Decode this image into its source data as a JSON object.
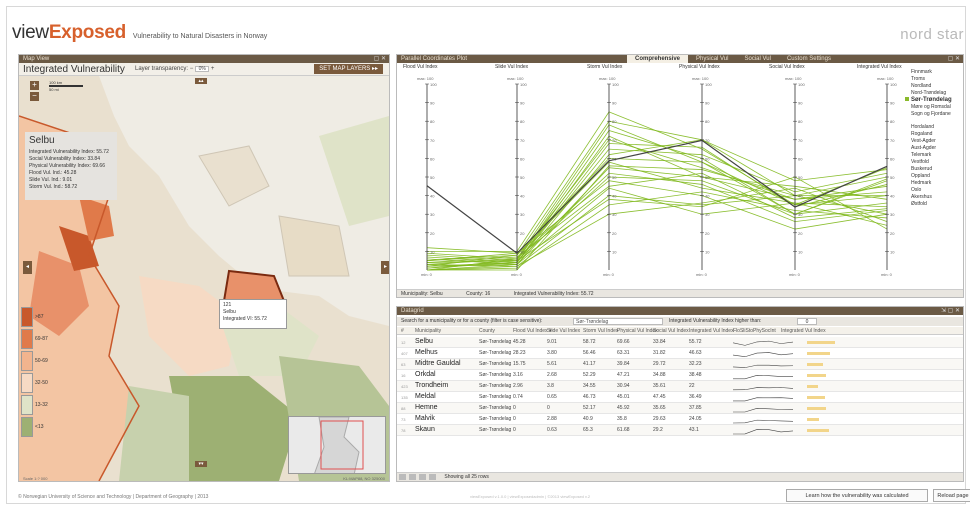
{
  "header": {
    "logo_view": "view",
    "logo_exposed": "Exposed",
    "subtitle": "Vulnerability to Natural Disasters in Norway",
    "brand": "nord star"
  },
  "map": {
    "panel_title": "Map View",
    "map_name": "Integrated Vulnerability",
    "transparency_label": "Layer transparency:",
    "transparency_value": "0%",
    "set_layers": "SET MAP LAYERS",
    "scale_top": "100 km",
    "scale_bottom": "50 mi",
    "info": {
      "name": "Selbu",
      "lines": [
        "Integrated Vulnerability Index: 55.72",
        "Social Vulnerability Index: 33.84",
        "Physical Vulnerability Index: 69.66",
        "Flood Vul. Ind.: 45.28",
        "Slide Vul. Ind.: 9.01",
        "Storm Vul. Ind.: 58.72"
      ]
    },
    "legend": [
      {
        "label": ">87",
        "color": "#c8582b"
      },
      {
        "label": "69-87",
        "color": "#e07a4a"
      },
      {
        "label": "50-69",
        "color": "#f2b48e"
      },
      {
        "label": "32-50",
        "color": "#f6dac4"
      },
      {
        "label": "13-32",
        "color": "#dfe3c8"
      },
      {
        "label": "<13",
        "color": "#9db073"
      }
    ],
    "tooltip": {
      "code": "121",
      "name": "Selbu",
      "value": "Integrated VI: 55.72"
    },
    "footer_left": "Scale 1:? 000",
    "footer_right": "KL:MAP88, NO 325000"
  },
  "parallel": {
    "panel_title": "Parallel Coordinates Plot",
    "tabs": [
      {
        "label": "Comprehensive",
        "active": true
      },
      {
        "label": "Physical Vul",
        "active": false
      },
      {
        "label": "Social Vul",
        "active": false
      },
      {
        "label": "Custom Settings",
        "active": false
      }
    ],
    "axes": [
      "Flood Vul Index",
      "Slide Vul Index",
      "Storm Vul Index",
      "Physical Vul Index",
      "Social Vul Index",
      "Integrated Vul Index"
    ],
    "axis_max": "max:  100",
    "axis_min": "min:  0",
    "ticks": [
      "100",
      "90",
      "80",
      "70",
      "60",
      "50",
      "40",
      "30",
      "20",
      "10"
    ],
    "footer": {
      "municipality": "Municipality: Selbu",
      "county": "County: 16",
      "integrated": "Integrated Vulnerability Index: 55.72"
    },
    "counties": [
      "Finnmark",
      "Troms",
      "Nordland",
      "Nord-Trøndelag",
      "Sør-Trøndelag",
      "Møre og Romsdal",
      "Sogn og Fjordane",
      "",
      "Hordaland",
      "Rogaland",
      "Vest-Agder",
      "Aust-Agder",
      "Telemark",
      "Vestfold",
      "Buskerud",
      "Oppland",
      "Hedmark",
      "Oslo",
      "Akershus",
      "Østfold"
    ],
    "selected_county": "Sør-Trøndelag"
  },
  "grid": {
    "panel_title": "Datagrid",
    "search_label": "Search for a municipality or for a county (filter is case sensitive):",
    "search_value": "Sør-Trøndelag",
    "threshold_label": "Integrated Vulnerability Index higher than:",
    "threshold_value": "0",
    "columns": [
      "#",
      "Municipality",
      "County",
      "Flood Vul Index ▾",
      "Slide Vul Index",
      "Storm Vul Index",
      "Physical Vul Index",
      "Social Vul Index",
      "Integrated Vul Index",
      "FloSliStoPhySocInt",
      "Integrated Vul Index"
    ],
    "rows": [
      {
        "code": "12",
        "name": "Selbu",
        "county": "Sør-Trøndelag",
        "flood": "45.28",
        "slide": "9.01",
        "storm": "58.72",
        "phys": "69.66",
        "soc": "33.84",
        "integ": "55.72"
      },
      {
        "code": "407",
        "name": "Melhus",
        "county": "Sør-Trøndelag",
        "flood": "28.23",
        "slide": "3.80",
        "storm": "56.46",
        "phys": "63.31",
        "soc": "31.82",
        "integ": "46.63"
      },
      {
        "code": "63",
        "name": "Midtre Gauldal",
        "county": "Sør-Trøndelag",
        "flood": "15.75",
        "slide": "5.61",
        "storm": "41.17",
        "phys": "39.84",
        "soc": "29.72",
        "integ": "32.23"
      },
      {
        "code": "16",
        "name": "Orkdal",
        "county": "Sør-Trøndelag",
        "flood": "3.16",
        "slide": "2.68",
        "storm": "52.29",
        "phys": "47.21",
        "soc": "34.88",
        "integ": "38.48"
      },
      {
        "code": "423",
        "name": "Trondheim",
        "county": "Sør-Trøndelag",
        "flood": "2.96",
        "slide": "3.8",
        "storm": "34.55",
        "phys": "30.94",
        "soc": "35.61",
        "integ": "22"
      },
      {
        "code": "135",
        "name": "Meldal",
        "county": "Sør-Trøndelag",
        "flood": "0.74",
        "slide": "0.65",
        "storm": "46.73",
        "phys": "45.01",
        "soc": "47.45",
        "integ": "36.49"
      },
      {
        "code": "88",
        "name": "Hemne",
        "county": "Sør-Trøndelag",
        "flood": "0",
        "slide": "0",
        "storm": "52.17",
        "phys": "45.92",
        "soc": "35.65",
        "integ": "37.85"
      },
      {
        "code": "73",
        "name": "Malvik",
        "county": "Sør-Trøndelag",
        "flood": "0",
        "slide": "2.88",
        "storm": "40.9",
        "phys": "35.8",
        "soc": "29.63",
        "integ": "24.05"
      },
      {
        "code": "78",
        "name": "Skaun",
        "county": "Sør-Trøndelag",
        "flood": "0",
        "slide": "0.63",
        "storm": "65.3",
        "phys": "61.68",
        "soc": "29.2",
        "integ": "43.1"
      }
    ],
    "footer": "Showing all 25 rows"
  },
  "footer": {
    "credit": "© Norwegian University of Science and Technology  |  Department of Geography  |  2013",
    "version": "viewExposed v.1.0.0 | viewExposedadmin | ©2013 viewExposed v.2",
    "learn": "Learn how the vulnerability was calculated",
    "reload": "Reload page"
  },
  "colors": {
    "accent": "#d7602c",
    "panel_title": "#6b5a45",
    "line_green": "#7fb81c",
    "line_dark": "#444444"
  }
}
